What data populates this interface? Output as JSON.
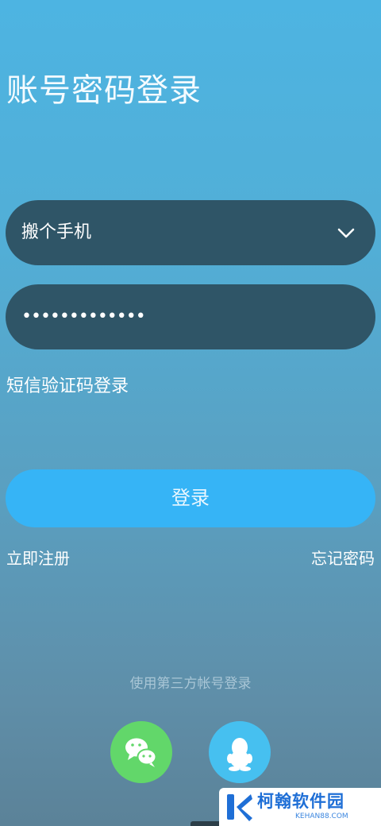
{
  "header": {
    "title": "账号密码登录"
  },
  "form": {
    "account_value": "搬个手机",
    "password_mask": "•••••••••••••",
    "sms_login_label": "短信验证码登录",
    "submit_label": "登录"
  },
  "links": {
    "register_label": "立即注册",
    "forgot_label": "忘记密码"
  },
  "third_party": {
    "label": "使用第三方帐号登录",
    "providers": [
      {
        "name": "wechat-icon",
        "color": "#62d76a"
      },
      {
        "name": "qq-icon",
        "color": "#46c0f0"
      }
    ]
  },
  "watermark": {
    "brand": "柯翰软件园",
    "domain": "KEHAN88.COM"
  },
  "colors": {
    "field_bg": "#2f5567",
    "button_bg": "#36b4f6"
  }
}
